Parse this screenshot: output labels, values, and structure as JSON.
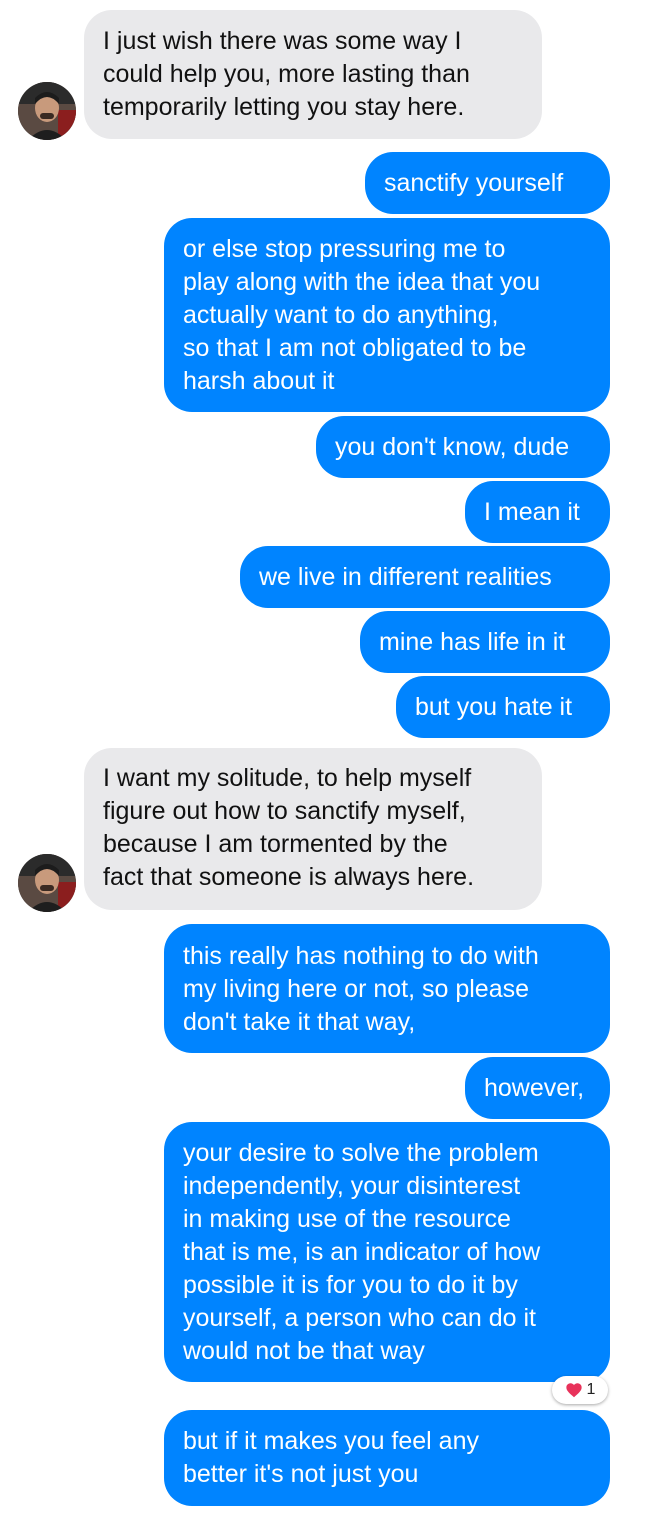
{
  "messages": [
    {
      "from": "them",
      "lines": [
        "I just wish there was some way I",
        "could help you, more lasting than",
        "temporarily letting you stay here."
      ]
    },
    {
      "from": "me",
      "lines": [
        "sanctify yourself"
      ]
    },
    {
      "from": "me",
      "lines": [
        "or else stop pressuring me to",
        "play along with the idea that you",
        "actually want to do anything,",
        "so that I am not obligated to be",
        "harsh about it"
      ]
    },
    {
      "from": "me",
      "lines": [
        "you don't know, dude"
      ]
    },
    {
      "from": "me",
      "lines": [
        "I mean it"
      ]
    },
    {
      "from": "me",
      "lines": [
        "we live in different realities"
      ]
    },
    {
      "from": "me",
      "lines": [
        "mine has life in it"
      ]
    },
    {
      "from": "me",
      "lines": [
        "but you hate it"
      ]
    },
    {
      "from": "them",
      "lines": [
        "I want my solitude, to help myself",
        "figure out how to sanctify myself,",
        "because I am tormented by the",
        "fact that someone is always here."
      ]
    },
    {
      "from": "me",
      "lines": [
        "this really has nothing to do with",
        "my living here or not, so please",
        "don't take it that way,"
      ]
    },
    {
      "from": "me",
      "lines": [
        "however,"
      ]
    },
    {
      "from": "me",
      "lines": [
        "your desire to solve the problem",
        "independently, your disinterest",
        "in making use of the resource",
        "that is me, is an indicator of how",
        "possible it is for you to do it by",
        "yourself, a person who can do it",
        "would not be that way"
      ]
    },
    {
      "from": "me",
      "lines": [
        "but if it makes you feel any",
        "better it's not just you"
      ]
    }
  ],
  "reaction": {
    "icon": "heart-icon",
    "count": "1",
    "color": "#e8325a"
  },
  "colors": {
    "outgoing": "#0084ff",
    "incoming": "#e9e9eb"
  }
}
